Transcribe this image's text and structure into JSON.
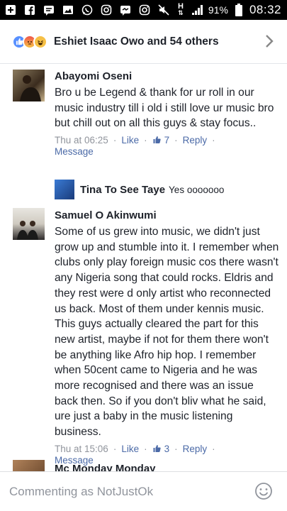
{
  "status_bar": {
    "battery": "91%",
    "time": "08:32",
    "network": "H"
  },
  "reactions": {
    "summary": "Eshiet Isaac Owo and 54 others",
    "icons": [
      "like-reaction",
      "angry-reaction",
      "haha-reaction"
    ]
  },
  "comments": [
    {
      "author": "Abayomi Oseni",
      "text": "Bro u  be Legend & thank for ur roll in our music industry till i old i still love ur music bro but chill out on all this guys & stay focus..",
      "time": "Thu at 06:25",
      "like_label": "Like",
      "like_count": "7",
      "reply_label": "Reply",
      "message_label": "Message"
    },
    {
      "author": "Samuel O Akinwumi",
      "text": "Some of us grew into music, we didn't just grow up and stumble into it. I remember when clubs only play foreign music cos there wasn't any Nigeria song that could rocks. Eldris and they rest were d only artist who reconnected us back. Most of them under kennis music. This guys actually cleared the part for this new artist, maybe if not for them there won't be anything like Afro hip hop. I remember when 50cent came to Nigeria and he was more recognised and there was an issue back then. So if you don't bliv what he said, ure just a baby in the music listening business.",
      "time": "Thu at 15:06",
      "like_label": "Like",
      "like_count": "3",
      "reply_label": "Reply",
      "message_label": "Message"
    },
    {
      "author": "Mc Monday Monday"
    }
  ],
  "reply": {
    "author": "Tina To See Taye",
    "text": "Yes ooooooo"
  },
  "composer": {
    "placeholder": "Commenting as NotJustOk"
  },
  "colors": {
    "link": "#4b6aa7",
    "meta": "#90949c",
    "text": "#1d2129",
    "like_blue": "#5890ff"
  }
}
